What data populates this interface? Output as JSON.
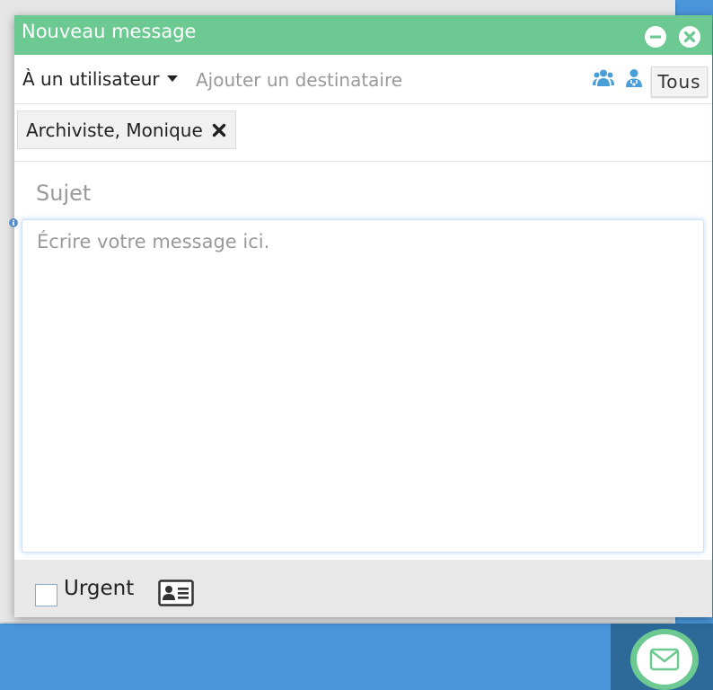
{
  "dialog": {
    "title": "Nouveau message",
    "minimize_icon": "minus-circle-icon",
    "close_icon": "close-circle-icon"
  },
  "recipients": {
    "mode_label": "À un utilisateur",
    "mode_icon": "caret-down-icon",
    "input_placeholder": "Ajouter un destinataire",
    "group_icon": "users-group-icon",
    "user_icon": "user-doctor-icon",
    "all_label": "Tous",
    "chips": [
      {
        "label": "Archiviste, Monique",
        "remove_icon": "close-x-icon"
      }
    ]
  },
  "subject": {
    "placeholder": "Sujet",
    "value": ""
  },
  "info_icon": "info-icon",
  "body": {
    "placeholder": "Écrire votre message ici.",
    "value": ""
  },
  "footer": {
    "urgent_label": "Urgent",
    "urgent_checked": false,
    "contact_icon": "contact-card-icon"
  },
  "mail_button_icon": "envelope-icon",
  "colors": {
    "accent": "#6cc991",
    "icon_blue": "#4a9fd8",
    "desktop_blue": "#4a96db"
  }
}
